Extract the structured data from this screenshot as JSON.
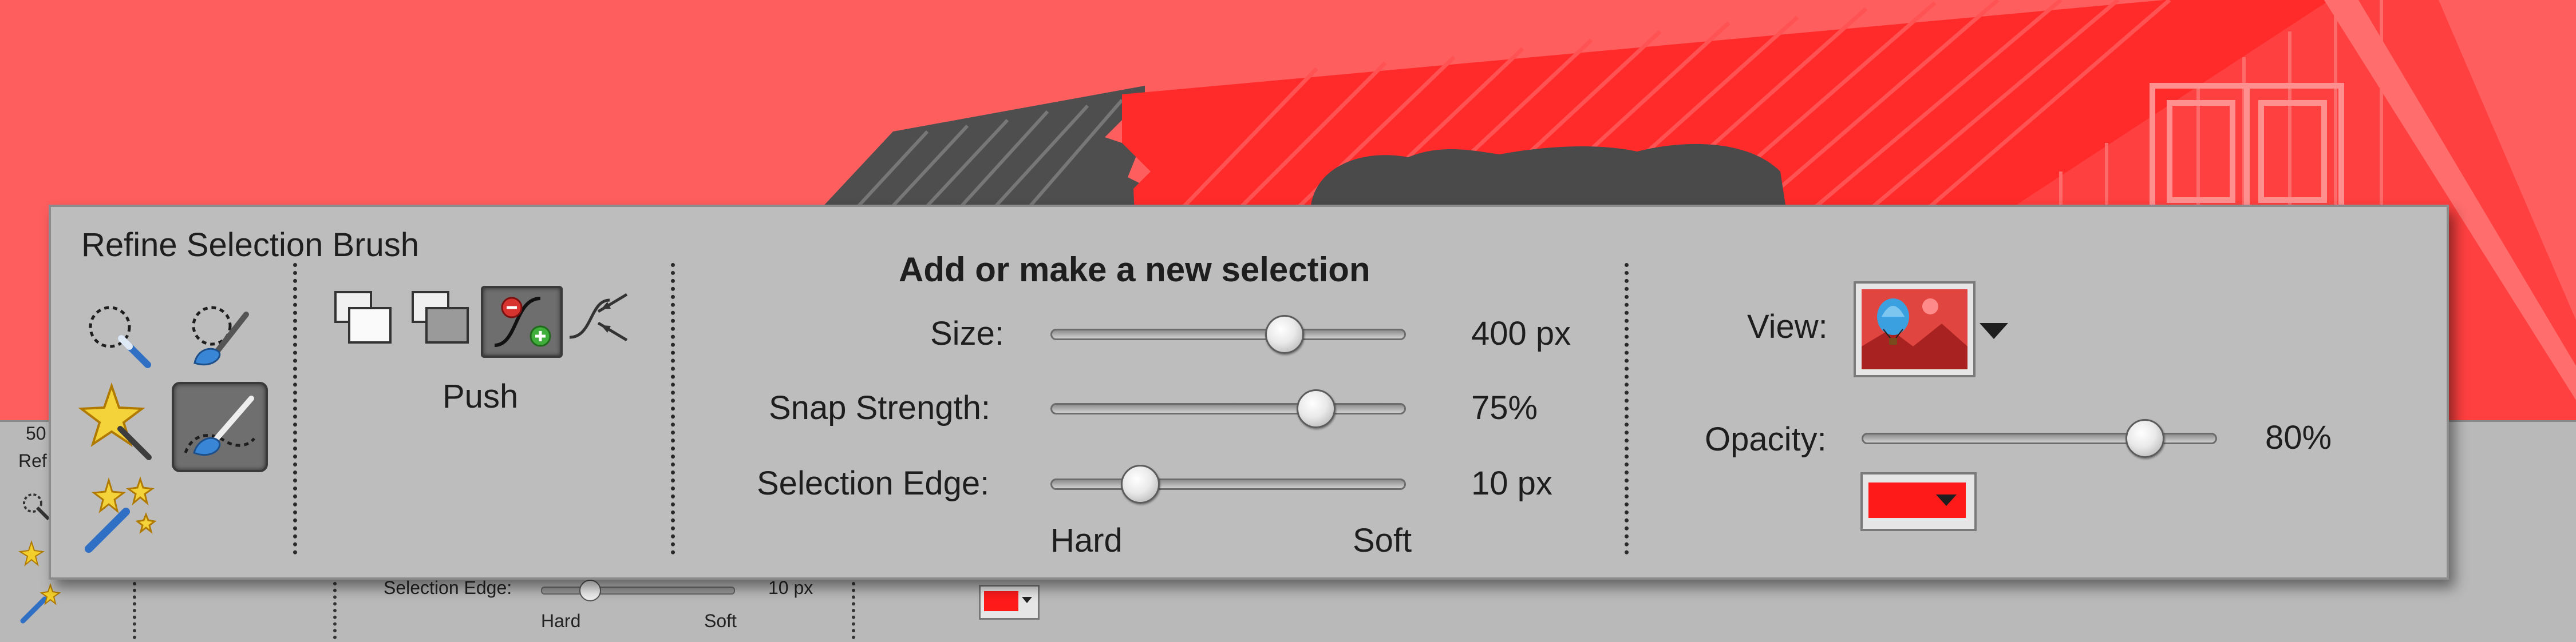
{
  "colors": {
    "overlay_red": "#ff5a5a",
    "roof_red": "#ff2b2b",
    "roof_grey": "#555555",
    "panel_bg": "#bdbdbd",
    "swatch_red": "#ff1a1a"
  },
  "background_panel": {
    "zoom_value": "50",
    "panel_title_fragment": "Ref",
    "selection_edge_label": "Selection Edge:",
    "selection_edge_value": "10 px",
    "hard_label": "Hard",
    "soft_label": "Soft"
  },
  "panel": {
    "title": "Refine Selection Brush",
    "tools": [
      {
        "name": "quick-selection-tool",
        "icon": "dotted-wand-icon",
        "selected": false
      },
      {
        "name": "selection-brush-tool",
        "icon": "dotted-brush-icon",
        "selected": false
      },
      {
        "name": "magic-wand-tool",
        "icon": "magic-wand-icon",
        "selected": false
      },
      {
        "name": "refine-selection-brush-tool",
        "icon": "refine-brush-icon",
        "selected": true
      },
      {
        "name": "auto-selection-tool",
        "icon": "sparkle-wand-icon",
        "selected": false
      }
    ],
    "modes": {
      "label": "Push",
      "buttons": [
        {
          "name": "new-selection",
          "icon": "new-selection-icon",
          "selected": false
        },
        {
          "name": "add-to-selection",
          "icon": "add-selection-icon",
          "selected": false
        },
        {
          "name": "push",
          "icon": "push-icon",
          "selected": true
        },
        {
          "name": "smooth",
          "icon": "smooth-icon",
          "selected": false
        }
      ]
    },
    "heading": "Add or make a new selection",
    "sliders": [
      {
        "label": "Size:",
        "value_text": "400 px",
        "fraction": 0.66
      },
      {
        "label": "Snap Strength:",
        "value_text": "75%",
        "fraction": 0.75
      },
      {
        "label": "Selection Edge:",
        "value_text": "10 px",
        "fraction": 0.25
      }
    ],
    "edge_min_label": "Hard",
    "edge_max_label": "Soft",
    "view_label": "View:",
    "view_icon": "balloon-landscape-icon",
    "opacity": {
      "label": "Opacity:",
      "value_text": "80%",
      "fraction": 0.8
    },
    "overlay_color_icon": "color-swatch-icon"
  }
}
